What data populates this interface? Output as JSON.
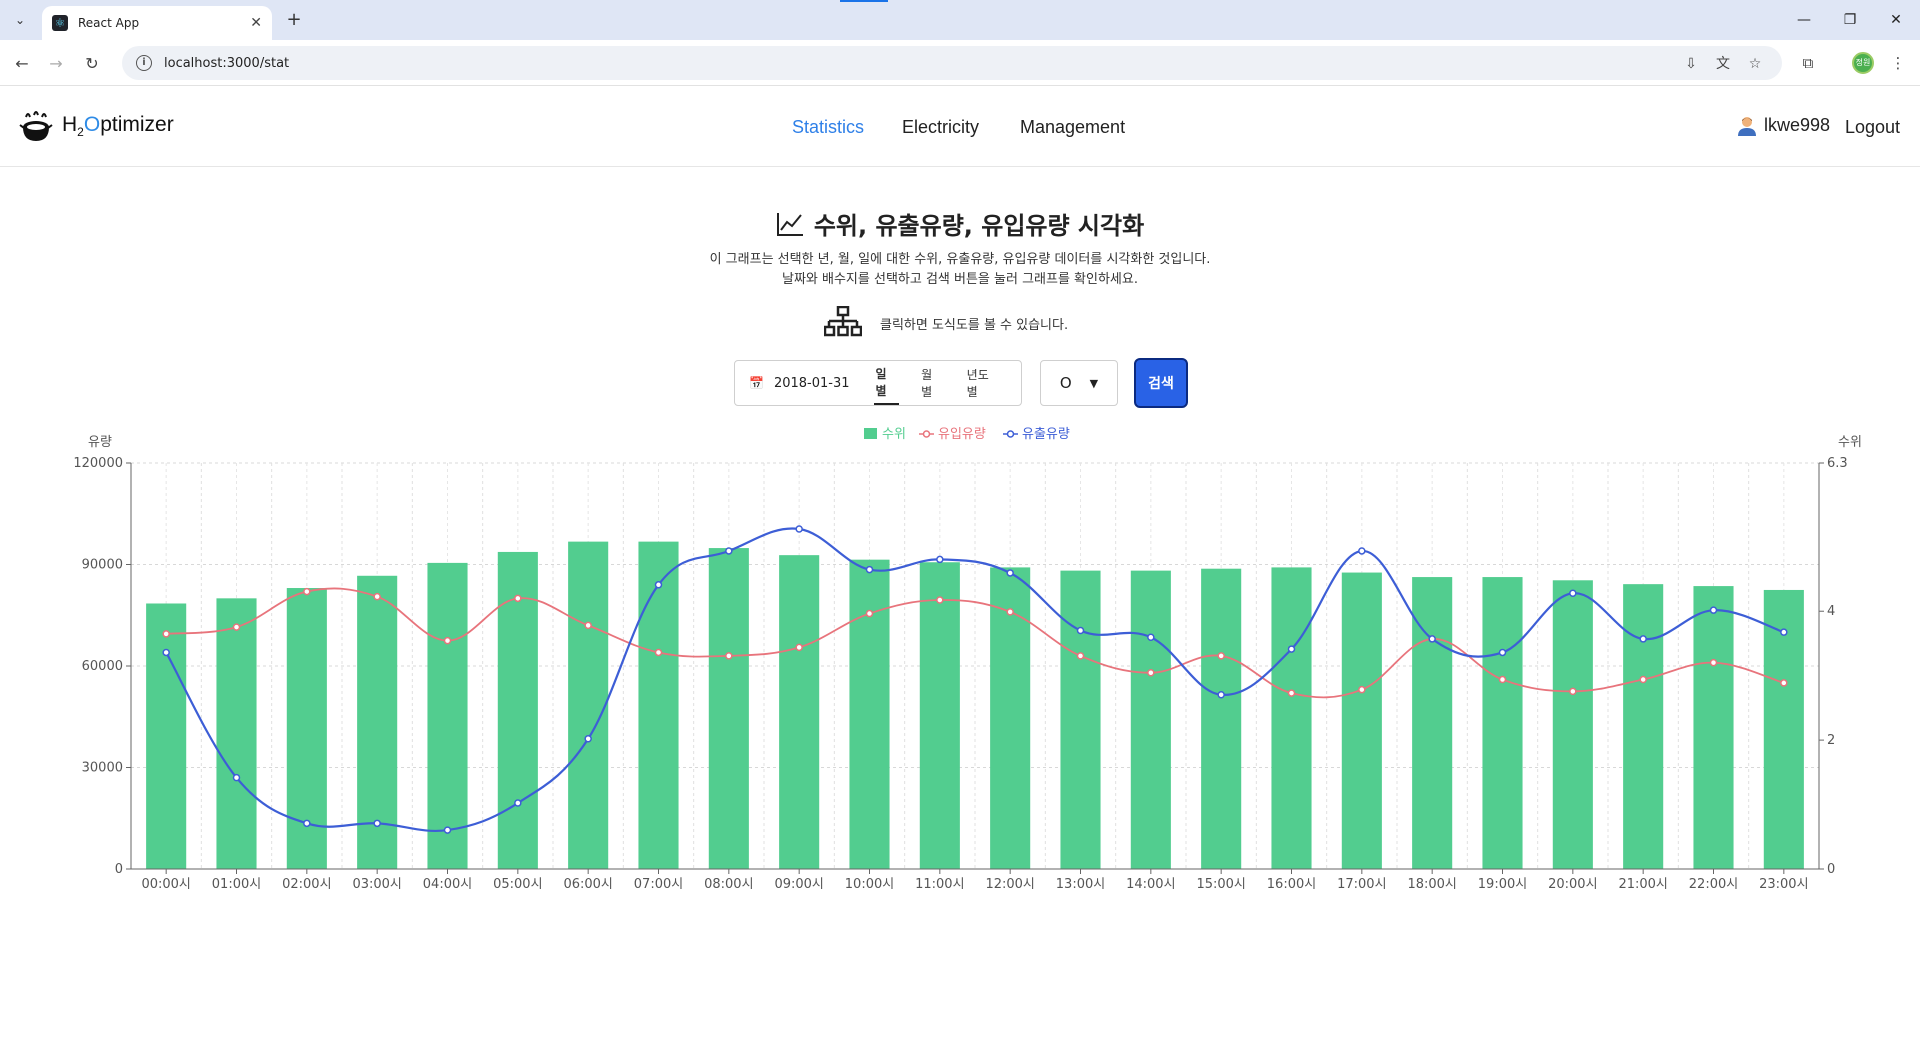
{
  "browser": {
    "tab_title": "React App",
    "url": "localhost:3000/stat",
    "profile_initials": "정원"
  },
  "app": {
    "logo_prefix": "H",
    "logo_sub": "2",
    "logo_o": "O",
    "logo_rest": "ptimizer",
    "menu": [
      "Statistics",
      "Electricity",
      "Management"
    ],
    "active_menu": "Statistics",
    "username": "lkwe998",
    "logout_label": "Logout"
  },
  "page": {
    "title": "수위, 유출유량, 유입유량 시각화",
    "desc_line1": "이 그래프는 선택한 년, 월, 일에 대한 수위, 유출유량, 유입유량 데이터를 시각화한 것입니다.",
    "desc_line2": "날짜와 배수지를 선택하고 검색 버튼을 눌러 그래프를 확인하세요.",
    "diagram_hint": "클릭하면 도식도를 볼 수 있습니다."
  },
  "controls": {
    "date_value": "2018-01-31",
    "period_tabs": [
      "일별",
      "월별",
      "년도별"
    ],
    "active_period": "일별",
    "reservoir_value": "O",
    "search_label": "검색"
  },
  "colors": {
    "bar": "#52cd8f",
    "inflow": "#e8747c",
    "outflow": "#3d5ed6",
    "accent": "#2f80e8",
    "search_button": "#2962e6"
  },
  "chart_data": {
    "type": "bar",
    "categories": [
      "00:00시",
      "01:00시",
      "02:00시",
      "03:00시",
      "04:00시",
      "05:00시",
      "06:00시",
      "07:00시",
      "08:00시",
      "09:00시",
      "10:00시",
      "11:00시",
      "12:00시",
      "13:00시",
      "14:00시",
      "15:00시",
      "16:00시",
      "17:00시",
      "18:00시",
      "19:00시",
      "20:00시",
      "21:00시",
      "22:00시",
      "23:00시"
    ],
    "left_axis_label": "유량",
    "right_axis_label": "수위",
    "left_ylim": [
      0,
      120000
    ],
    "left_ticks": [
      "0",
      "30000",
      "60000",
      "90000",
      "120000"
    ],
    "right_ylim": [
      0,
      6.3
    ],
    "right_ticks": [
      "0",
      "2",
      "4",
      "6.3"
    ],
    "grid": true,
    "legend_position": "top-center",
    "series": [
      {
        "name": "수위",
        "kind": "bar",
        "axis": "right",
        "color": "#52cd8f",
        "values": [
          4.12,
          4.2,
          4.36,
          4.55,
          4.75,
          4.92,
          5.08,
          5.08,
          4.98,
          4.87,
          4.8,
          4.76,
          4.68,
          4.63,
          4.63,
          4.66,
          4.68,
          4.6,
          4.53,
          4.53,
          4.48,
          4.42,
          4.39,
          4.33
        ]
      },
      {
        "name": "유입유량",
        "kind": "line",
        "axis": "left",
        "color": "#e8747c",
        "values": [
          69500,
          71500,
          82000,
          80500,
          67500,
          80000,
          72000,
          64000,
          63000,
          65500,
          75500,
          79500,
          76000,
          63000,
          58000,
          63000,
          52000,
          53000,
          68000,
          56000,
          52500,
          56000,
          61000,
          55000
        ]
      },
      {
        "name": "유출유량",
        "kind": "line",
        "axis": "left",
        "color": "#3d5ed6",
        "values": [
          64000,
          27000,
          13500,
          13500,
          11500,
          19500,
          38500,
          84000,
          94000,
          100500,
          88500,
          91500,
          87500,
          70500,
          68500,
          51500,
          65000,
          94000,
          68000,
          64000,
          81500,
          68000,
          76500,
          70000
        ]
      }
    ]
  }
}
